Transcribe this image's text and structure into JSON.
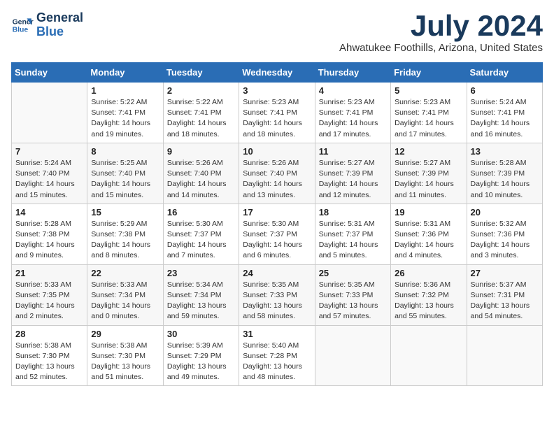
{
  "header": {
    "logo_line1": "General",
    "logo_line2": "Blue",
    "month": "July 2024",
    "location": "Ahwatukee Foothills, Arizona, United States"
  },
  "days_of_week": [
    "Sunday",
    "Monday",
    "Tuesday",
    "Wednesday",
    "Thursday",
    "Friday",
    "Saturday"
  ],
  "weeks": [
    [
      {
        "day": "",
        "info": ""
      },
      {
        "day": "1",
        "info": "Sunrise: 5:22 AM\nSunset: 7:41 PM\nDaylight: 14 hours\nand 19 minutes."
      },
      {
        "day": "2",
        "info": "Sunrise: 5:22 AM\nSunset: 7:41 PM\nDaylight: 14 hours\nand 18 minutes."
      },
      {
        "day": "3",
        "info": "Sunrise: 5:23 AM\nSunset: 7:41 PM\nDaylight: 14 hours\nand 18 minutes."
      },
      {
        "day": "4",
        "info": "Sunrise: 5:23 AM\nSunset: 7:41 PM\nDaylight: 14 hours\nand 17 minutes."
      },
      {
        "day": "5",
        "info": "Sunrise: 5:23 AM\nSunset: 7:41 PM\nDaylight: 14 hours\nand 17 minutes."
      },
      {
        "day": "6",
        "info": "Sunrise: 5:24 AM\nSunset: 7:41 PM\nDaylight: 14 hours\nand 16 minutes."
      }
    ],
    [
      {
        "day": "7",
        "info": "Sunrise: 5:24 AM\nSunset: 7:40 PM\nDaylight: 14 hours\nand 15 minutes."
      },
      {
        "day": "8",
        "info": "Sunrise: 5:25 AM\nSunset: 7:40 PM\nDaylight: 14 hours\nand 15 minutes."
      },
      {
        "day": "9",
        "info": "Sunrise: 5:26 AM\nSunset: 7:40 PM\nDaylight: 14 hours\nand 14 minutes."
      },
      {
        "day": "10",
        "info": "Sunrise: 5:26 AM\nSunset: 7:40 PM\nDaylight: 14 hours\nand 13 minutes."
      },
      {
        "day": "11",
        "info": "Sunrise: 5:27 AM\nSunset: 7:39 PM\nDaylight: 14 hours\nand 12 minutes."
      },
      {
        "day": "12",
        "info": "Sunrise: 5:27 AM\nSunset: 7:39 PM\nDaylight: 14 hours\nand 11 minutes."
      },
      {
        "day": "13",
        "info": "Sunrise: 5:28 AM\nSunset: 7:39 PM\nDaylight: 14 hours\nand 10 minutes."
      }
    ],
    [
      {
        "day": "14",
        "info": "Sunrise: 5:28 AM\nSunset: 7:38 PM\nDaylight: 14 hours\nand 9 minutes."
      },
      {
        "day": "15",
        "info": "Sunrise: 5:29 AM\nSunset: 7:38 PM\nDaylight: 14 hours\nand 8 minutes."
      },
      {
        "day": "16",
        "info": "Sunrise: 5:30 AM\nSunset: 7:37 PM\nDaylight: 14 hours\nand 7 minutes."
      },
      {
        "day": "17",
        "info": "Sunrise: 5:30 AM\nSunset: 7:37 PM\nDaylight: 14 hours\nand 6 minutes."
      },
      {
        "day": "18",
        "info": "Sunrise: 5:31 AM\nSunset: 7:37 PM\nDaylight: 14 hours\nand 5 minutes."
      },
      {
        "day": "19",
        "info": "Sunrise: 5:31 AM\nSunset: 7:36 PM\nDaylight: 14 hours\nand 4 minutes."
      },
      {
        "day": "20",
        "info": "Sunrise: 5:32 AM\nSunset: 7:36 PM\nDaylight: 14 hours\nand 3 minutes."
      }
    ],
    [
      {
        "day": "21",
        "info": "Sunrise: 5:33 AM\nSunset: 7:35 PM\nDaylight: 14 hours\nand 2 minutes."
      },
      {
        "day": "22",
        "info": "Sunrise: 5:33 AM\nSunset: 7:34 PM\nDaylight: 14 hours\nand 0 minutes."
      },
      {
        "day": "23",
        "info": "Sunrise: 5:34 AM\nSunset: 7:34 PM\nDaylight: 13 hours\nand 59 minutes."
      },
      {
        "day": "24",
        "info": "Sunrise: 5:35 AM\nSunset: 7:33 PM\nDaylight: 13 hours\nand 58 minutes."
      },
      {
        "day": "25",
        "info": "Sunrise: 5:35 AM\nSunset: 7:33 PM\nDaylight: 13 hours\nand 57 minutes."
      },
      {
        "day": "26",
        "info": "Sunrise: 5:36 AM\nSunset: 7:32 PM\nDaylight: 13 hours\nand 55 minutes."
      },
      {
        "day": "27",
        "info": "Sunrise: 5:37 AM\nSunset: 7:31 PM\nDaylight: 13 hours\nand 54 minutes."
      }
    ],
    [
      {
        "day": "28",
        "info": "Sunrise: 5:38 AM\nSunset: 7:30 PM\nDaylight: 13 hours\nand 52 minutes."
      },
      {
        "day": "29",
        "info": "Sunrise: 5:38 AM\nSunset: 7:30 PM\nDaylight: 13 hours\nand 51 minutes."
      },
      {
        "day": "30",
        "info": "Sunrise: 5:39 AM\nSunset: 7:29 PM\nDaylight: 13 hours\nand 49 minutes."
      },
      {
        "day": "31",
        "info": "Sunrise: 5:40 AM\nSunset: 7:28 PM\nDaylight: 13 hours\nand 48 minutes."
      },
      {
        "day": "",
        "info": ""
      },
      {
        "day": "",
        "info": ""
      },
      {
        "day": "",
        "info": ""
      }
    ]
  ]
}
